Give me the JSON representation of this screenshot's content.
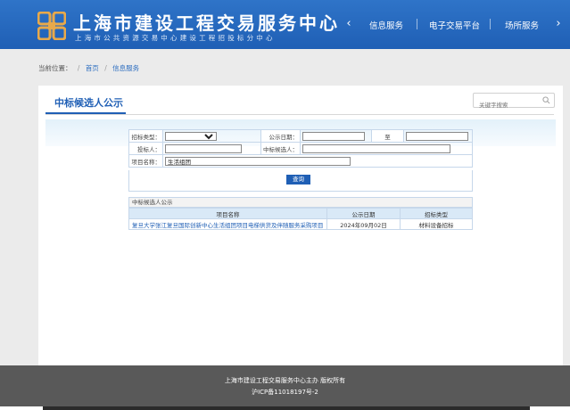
{
  "header": {
    "title": "上海市建设工程交易服务中心",
    "subtitle": "上海市公共资源交易中心建设工程招投标分中心",
    "nav": [
      {
        "label": "信息服务"
      },
      {
        "label": "电子交易平台"
      },
      {
        "label": "场所服务"
      }
    ],
    "prev_arrow": "‹",
    "next_arrow": "›",
    "brand_color": "#1f5fb5"
  },
  "breadcrumb": {
    "prefix": "当前位置：",
    "sep": "/",
    "items": [
      "首页",
      "信息服务"
    ]
  },
  "panel": {
    "title": "中标候选人公示",
    "search_placeholder": "关键字搜索"
  },
  "form": {
    "bid_type_label": "招标类型：",
    "bid_type_value": "",
    "publish_date_label": "公示日期：",
    "date_to_label": "至",
    "tenderer_label": "投标人：",
    "candidate_label": "中标候选人：",
    "project_name_label": "项目名称：",
    "project_name_value": "生活组团",
    "query_button": "查询"
  },
  "results": {
    "section_title": "中标候选人公示",
    "columns": [
      "项目名称",
      "公示日期",
      "招标类型"
    ],
    "rows": [
      {
        "project": "复旦大学张江复旦国际创新中心生活组团项目电梯供货及伴随服务采购项目",
        "date": "2024年09月02日",
        "type": "材料设备招标"
      }
    ]
  },
  "footer": {
    "line1": "上海市建设工程交易服务中心主办 版权所有",
    "line2": "沪ICP备11018197号-2"
  }
}
